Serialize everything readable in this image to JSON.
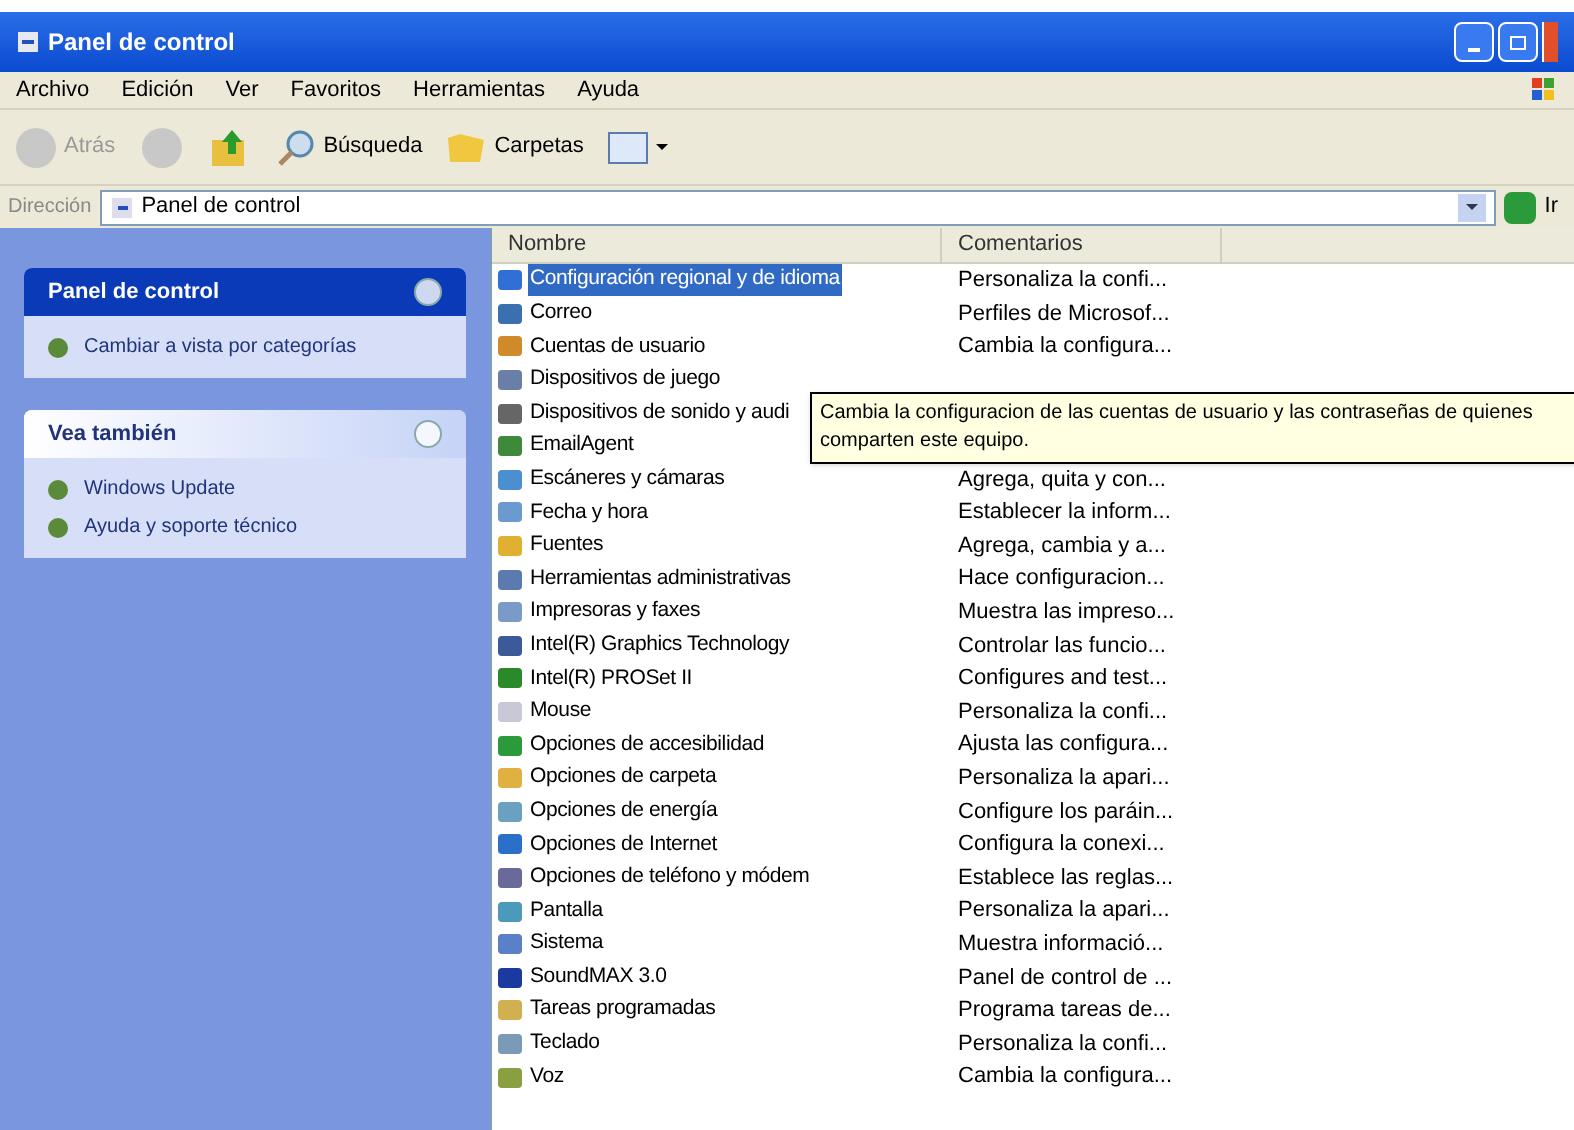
{
  "window": {
    "title": "Panel de control"
  },
  "menu": [
    "Archivo",
    "Edición",
    "Ver",
    "Favoritos",
    "Herramientas",
    "Ayuda"
  ],
  "toolbar": {
    "back": "Atrás",
    "search": "Búsqueda",
    "folders": "Carpetas"
  },
  "address": {
    "label": "Dirección",
    "value": "Panel de control",
    "go": "Ir"
  },
  "sidebar": [
    {
      "title": "Panel de control",
      "kind": "primary",
      "links": [
        "Cambiar a vista por categorías"
      ]
    },
    {
      "title": "Vea también",
      "kind": "secondary",
      "links": [
        "Windows Update",
        "Ayuda y soporte técnico"
      ]
    }
  ],
  "table": {
    "columns": [
      "Nombre",
      "Comentarios"
    ],
    "rows": [
      {
        "name": "Configuración regional y de idioma",
        "comment": "Personaliza la confi...",
        "selected": true
      },
      {
        "name": "Correo",
        "comment": "Perfiles de Microsof...",
        "selected": false
      },
      {
        "name": "Cuentas de usuario",
        "comment": "Cambia la configura...",
        "selected": false
      },
      {
        "name": "Dispositivos de juego",
        "selected": false
      },
      {
        "name": "Dispositivos de sonido y audi",
        "selected": false
      },
      {
        "name": "EmailAgent",
        "selected": false
      },
      {
        "name": "Escáneres y cámaras",
        "comment": "Agrega, quita y con...",
        "selected": false
      },
      {
        "name": "Fecha y hora",
        "comment": "Establecer la inform...",
        "selected": false
      },
      {
        "name": "Fuentes",
        "comment": "Agrega, cambia y a...",
        "selected": false
      },
      {
        "name": "Herramientas administrativas",
        "comment": "Hace configuracion...",
        "selected": false
      },
      {
        "name": "Impresoras y faxes",
        "comment": "Muestra las impreso...",
        "selected": false
      },
      {
        "name": "Intel(R) Graphics Technology",
        "comment": "Controlar las funcio...",
        "selected": false
      },
      {
        "name": "Intel(R) PROSet II",
        "comment": "Configures and test...",
        "selected": false
      },
      {
        "name": "Mouse",
        "comment": "Personaliza la confi...",
        "selected": false
      },
      {
        "name": "Opciones de accesibilidad",
        "comment": "Ajusta las configura...",
        "selected": false
      },
      {
        "name": "Opciones de carpeta",
        "comment": "Personaliza la apari...",
        "selected": false
      },
      {
        "name": "Opciones de energía",
        "comment": "Configure los paráin...",
        "selected": false
      },
      {
        "name": "Opciones de Internet",
        "comment": "Configura la conexi...",
        "selected": false
      },
      {
        "name": "Opciones de teléfono y módem",
        "comment": "Establece las reglas...",
        "selected": false
      },
      {
        "name": "Pantalla",
        "comment": "Personaliza la apari...",
        "selected": false
      },
      {
        "name": "Sistema",
        "comment": "Muestra informació...",
        "selected": false
      },
      {
        "name": "SoundMAX 3.0",
        "comment": "Panel de control de ...",
        "selected": false
      },
      {
        "name": "Tareas programadas",
        "comment": "Programa tareas de...",
        "selected": false
      },
      {
        "name": "Teclado",
        "comment": "Personaliza la confi...",
        "selected": false
      },
      {
        "name": "Voz",
        "comment": "Cambia la configura...",
        "selected": false
      }
    ]
  },
  "tooltip": "Cambia la configuracion de las cuentas de usuario y las contraseñas de quienes comparten este equipo."
}
